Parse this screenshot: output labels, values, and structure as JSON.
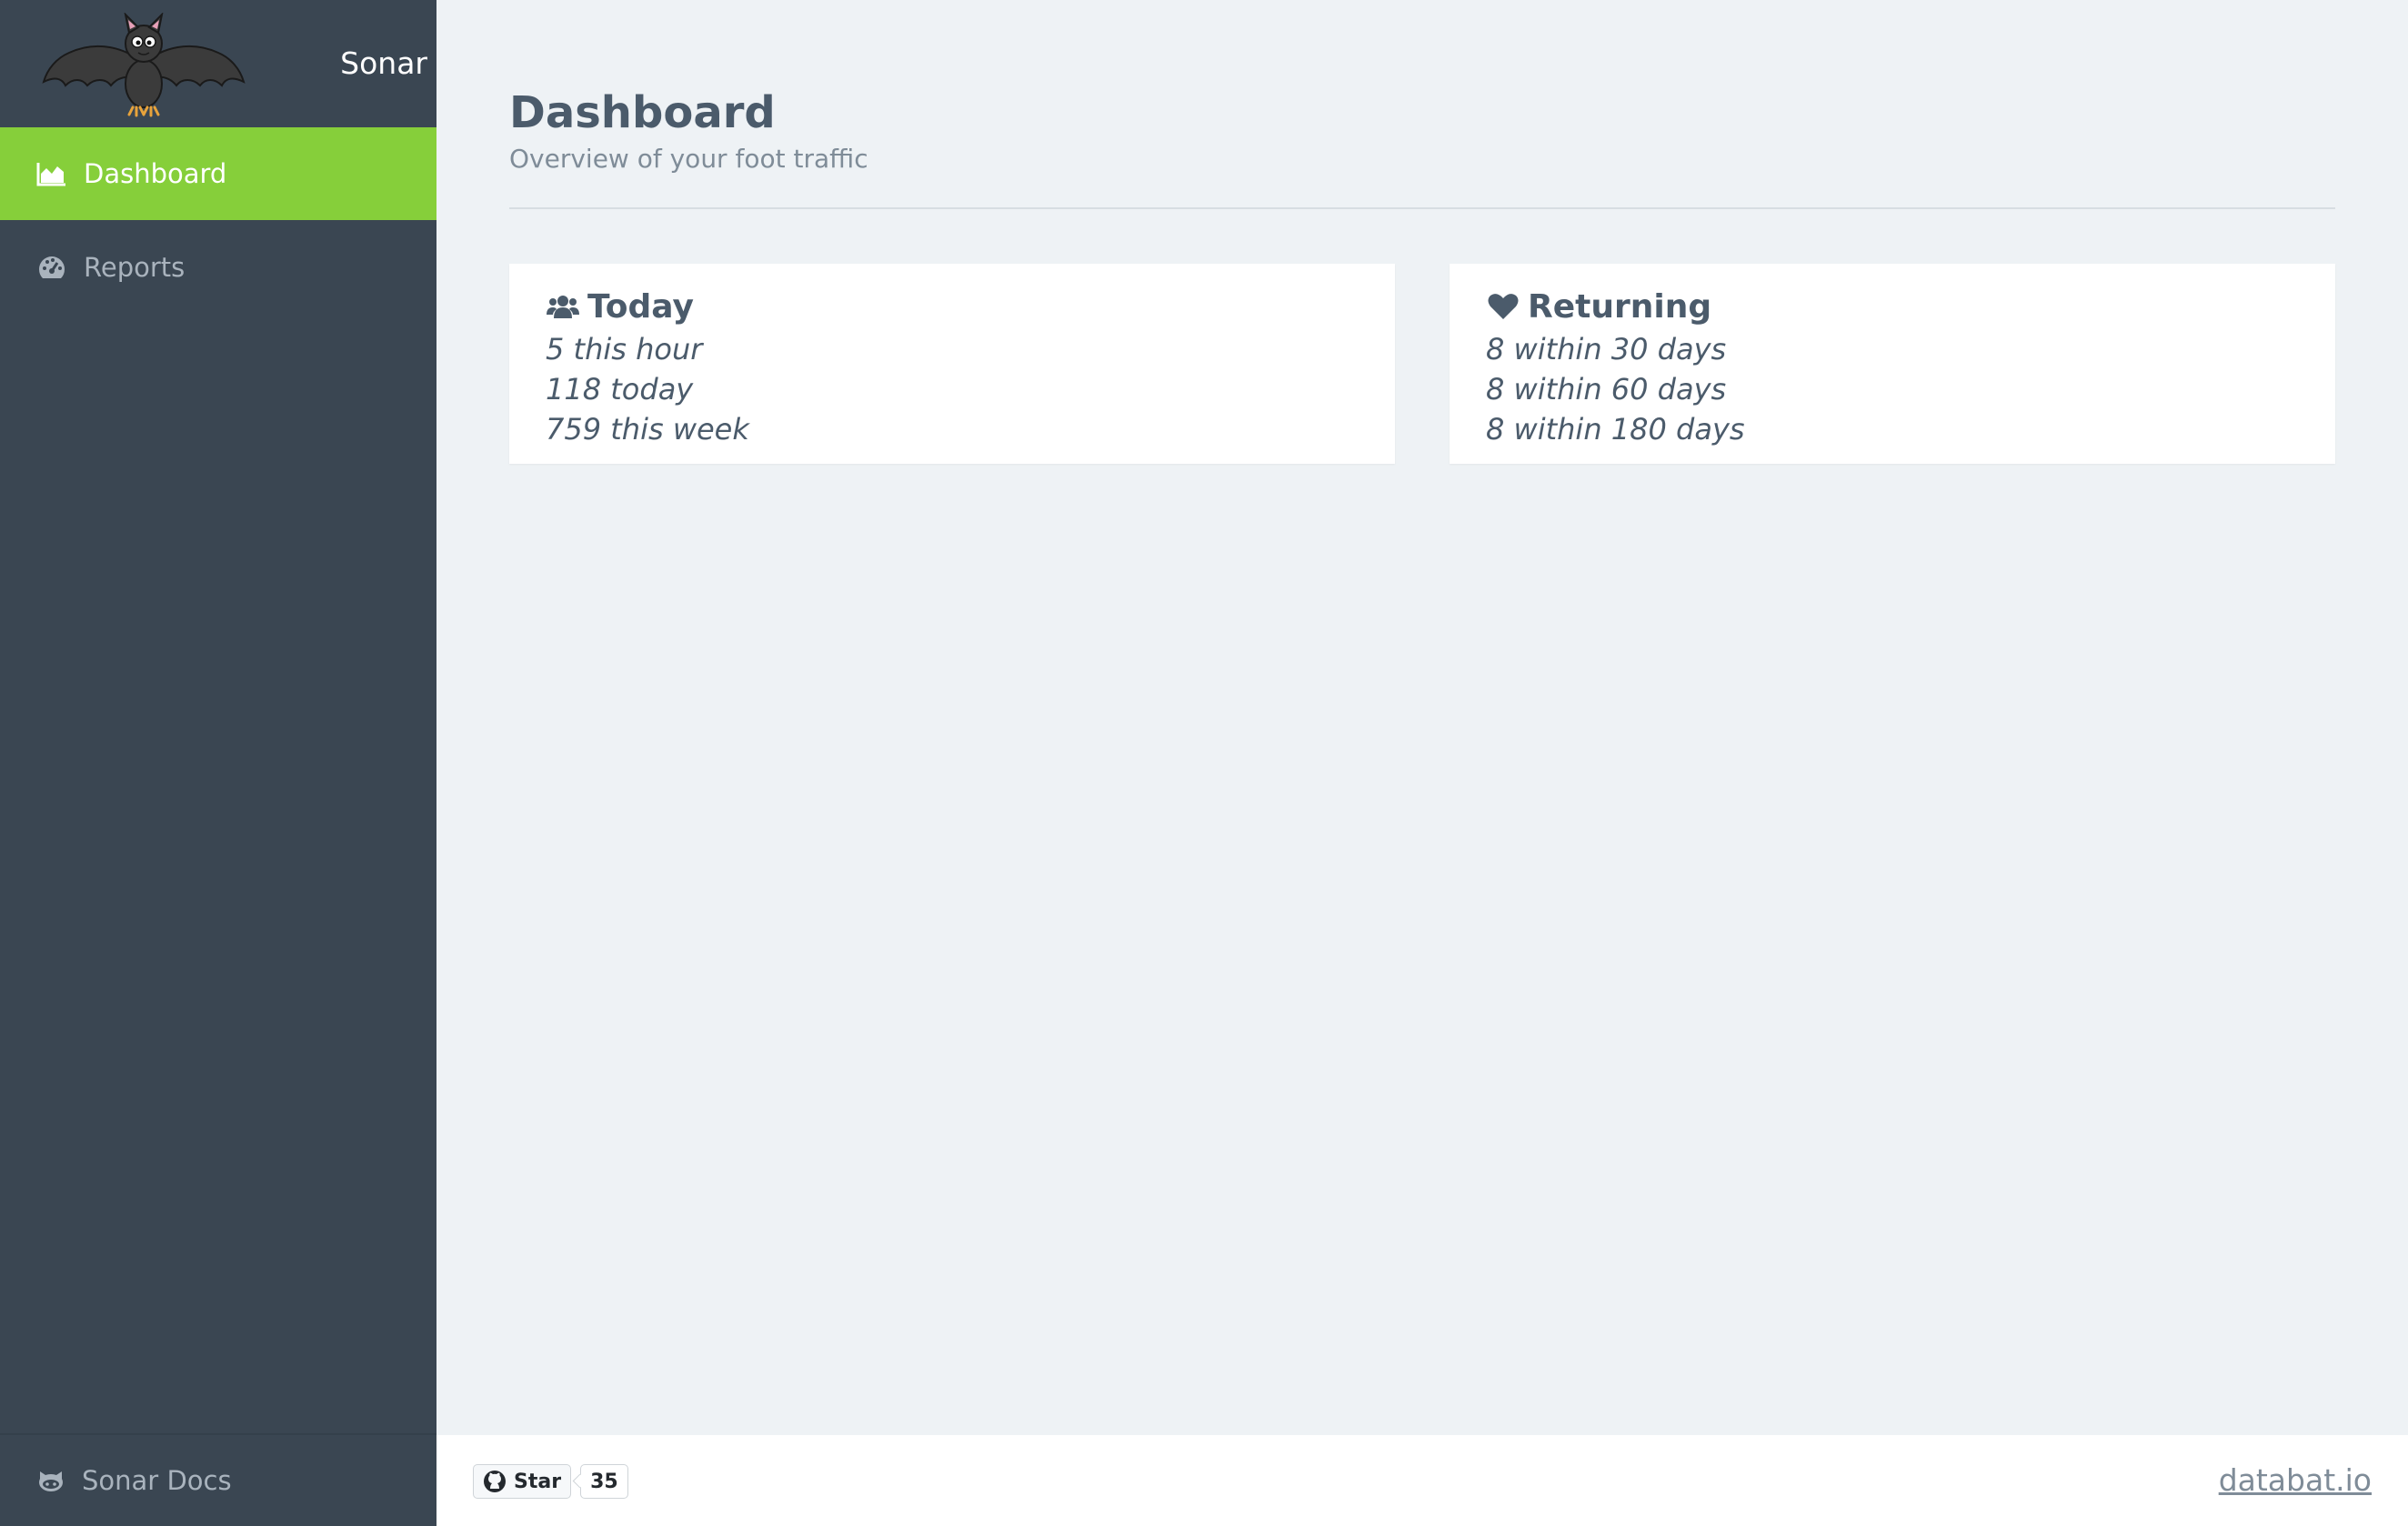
{
  "brand": {
    "name": "Sonar",
    "logo_icon": "bat-logo"
  },
  "nav": {
    "items": [
      {
        "label": "Dashboard",
        "icon": "area-chart-icon",
        "active": true
      },
      {
        "label": "Reports",
        "icon": "tachometer-icon",
        "active": false
      }
    ],
    "footer": {
      "label": "Sonar Docs",
      "icon": "github-icon"
    }
  },
  "page": {
    "title": "Dashboard",
    "subtitle": "Overview of your foot traffic"
  },
  "cards": {
    "today": {
      "title": "Today",
      "icon": "users-icon",
      "lines": [
        "5 this hour",
        "118 today",
        "759 this week"
      ]
    },
    "returning": {
      "title": "Returning",
      "icon": "heart-icon",
      "lines": [
        "8 within 30 days",
        "8 within 60 days",
        "8 within 180 days"
      ]
    }
  },
  "footer": {
    "star_label": "Star",
    "star_count": "35",
    "link_text": "databat.io"
  },
  "colors": {
    "sidebar_bg": "#3a4652",
    "active_nav": "#86cf3a",
    "main_bg": "#eef2f5",
    "text_dark": "#4b5b6b",
    "text_muted": "#7f8c98"
  }
}
